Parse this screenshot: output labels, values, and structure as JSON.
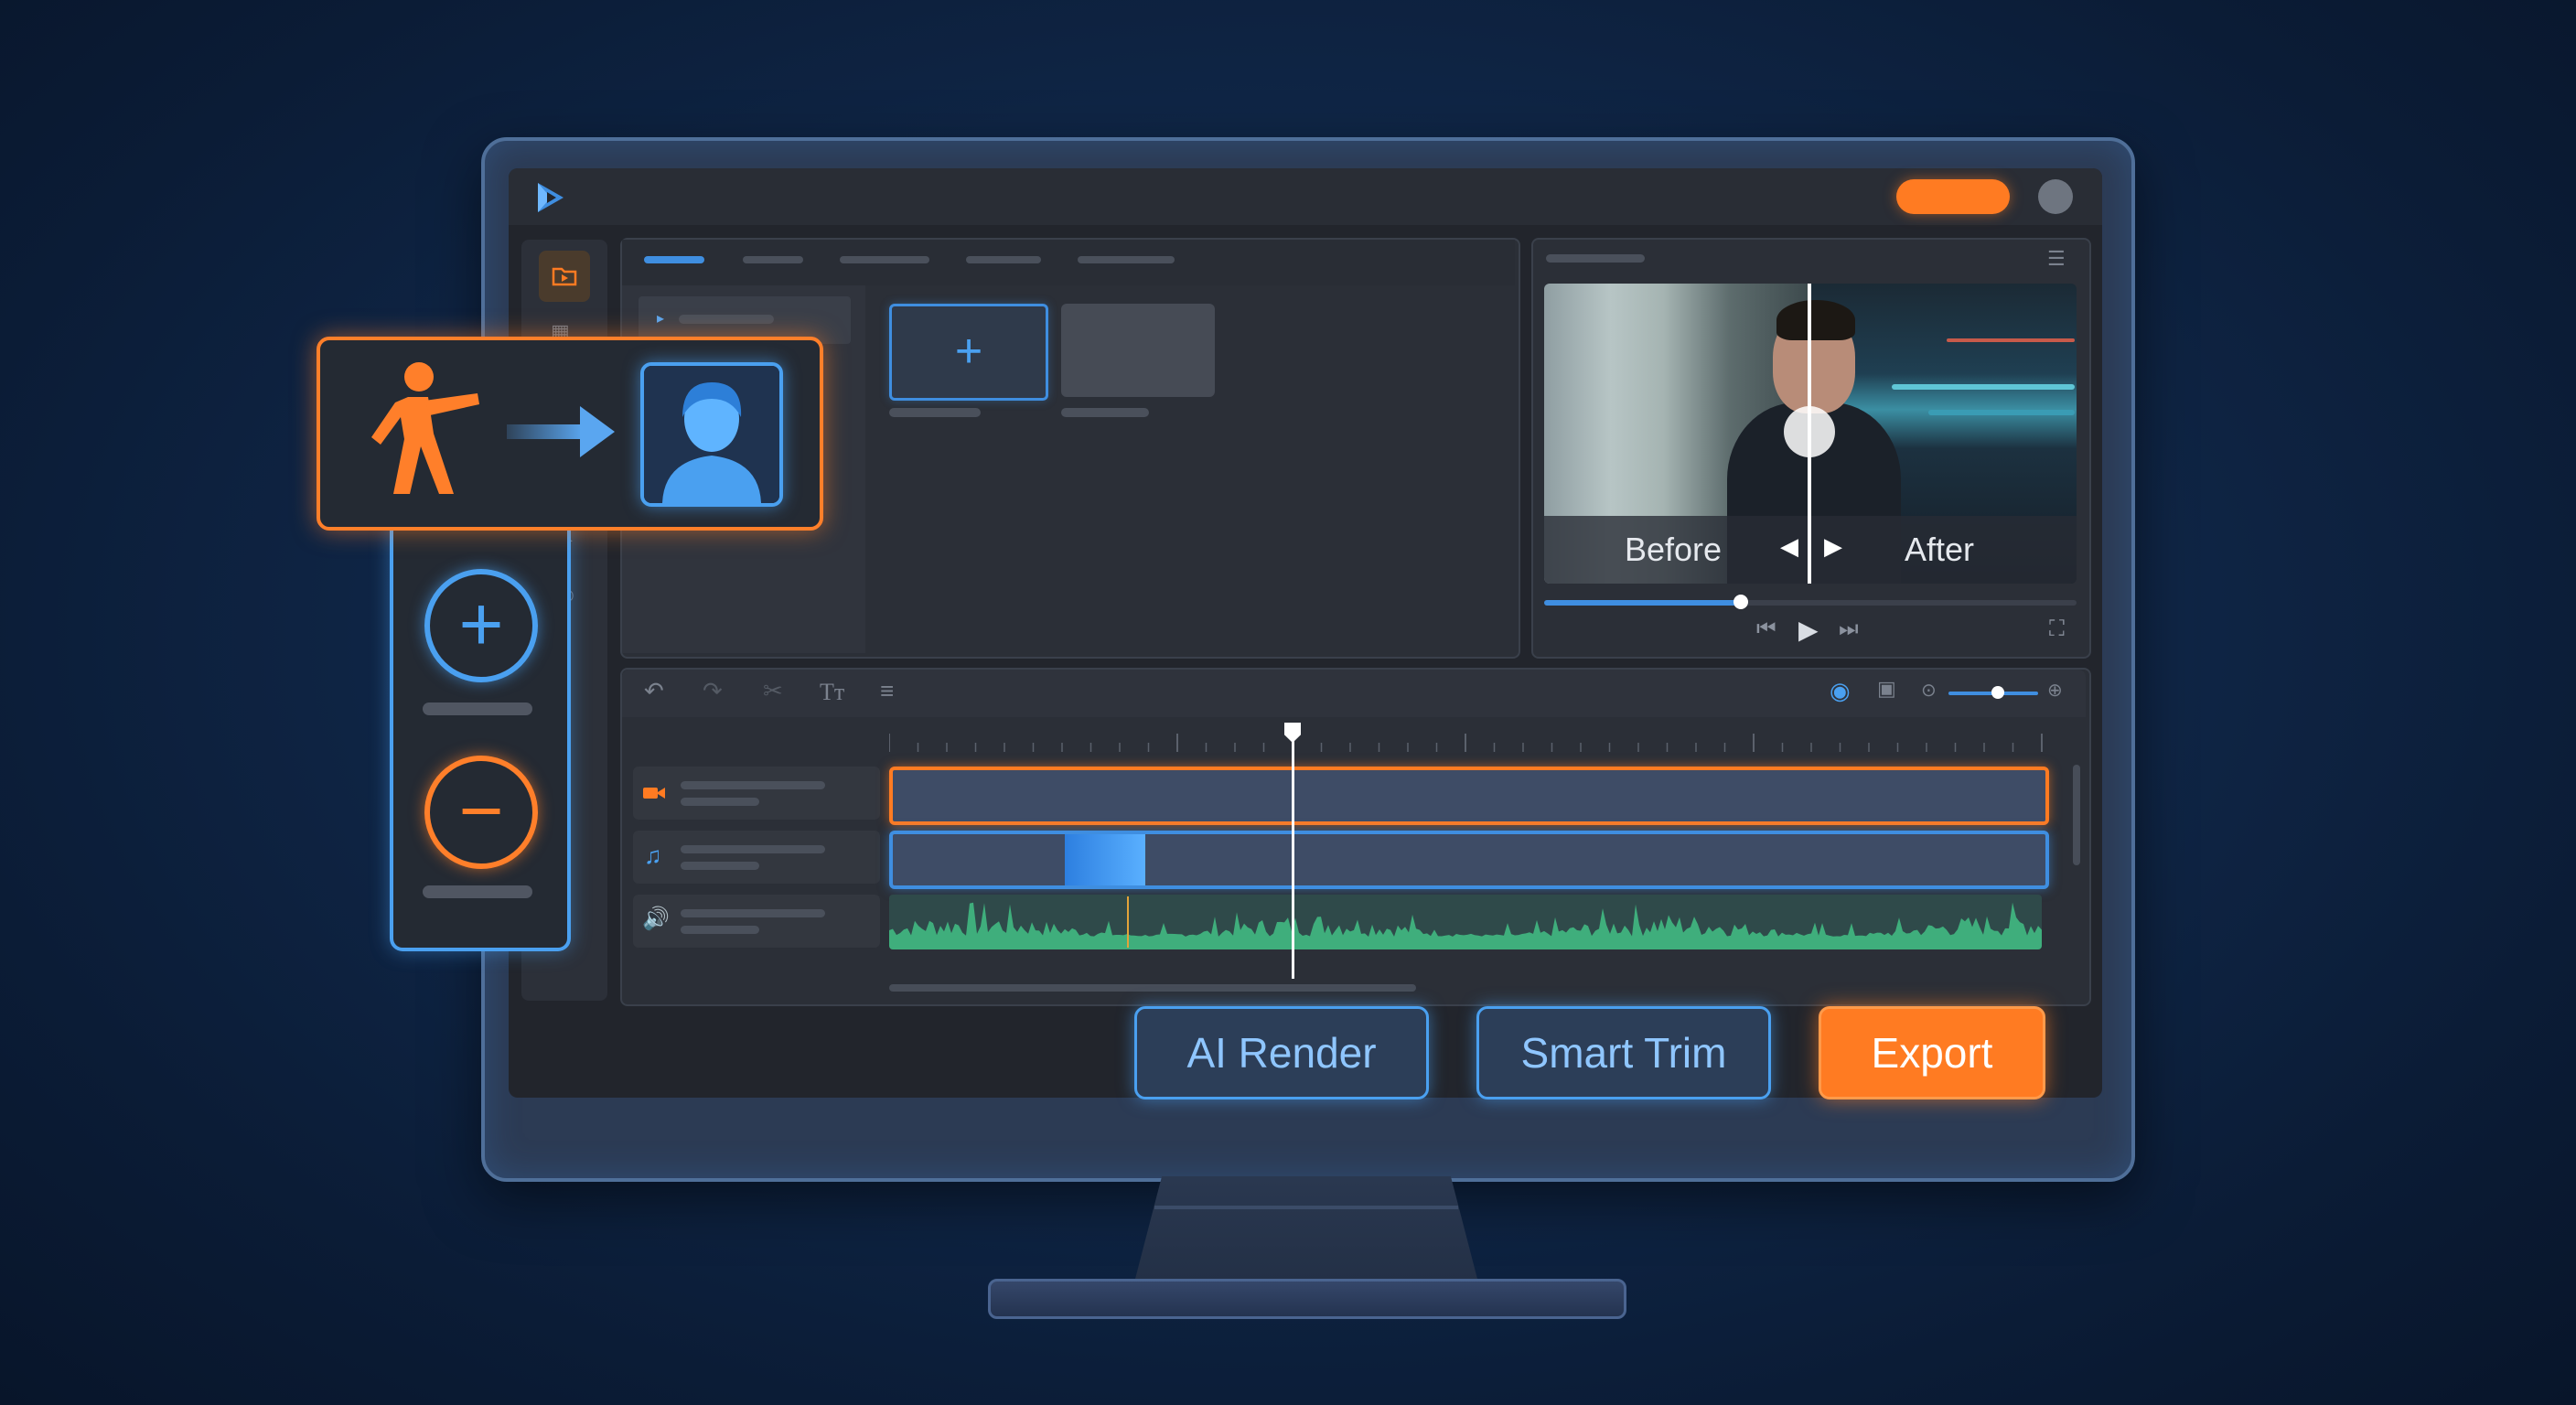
{
  "app": {
    "logo_icon": "play-triangle-logo-icon",
    "accent_orange": "#ff7b22",
    "accent_blue": "#3f8ee0",
    "waveform_green": "#3fae7c"
  },
  "preview": {
    "before_label": "Before",
    "after_label": "After",
    "progress": 0.37
  },
  "floating_panel": {
    "plus_symbol": "+",
    "minus_symbol": "−"
  },
  "media": {
    "add_symbol": "+"
  },
  "actions": {
    "ai_render": "AI Render",
    "smart_trim": "Smart Trim",
    "export": "Export"
  },
  "timeline": {
    "zoom": 0.55,
    "playhead_position": 0.35
  }
}
